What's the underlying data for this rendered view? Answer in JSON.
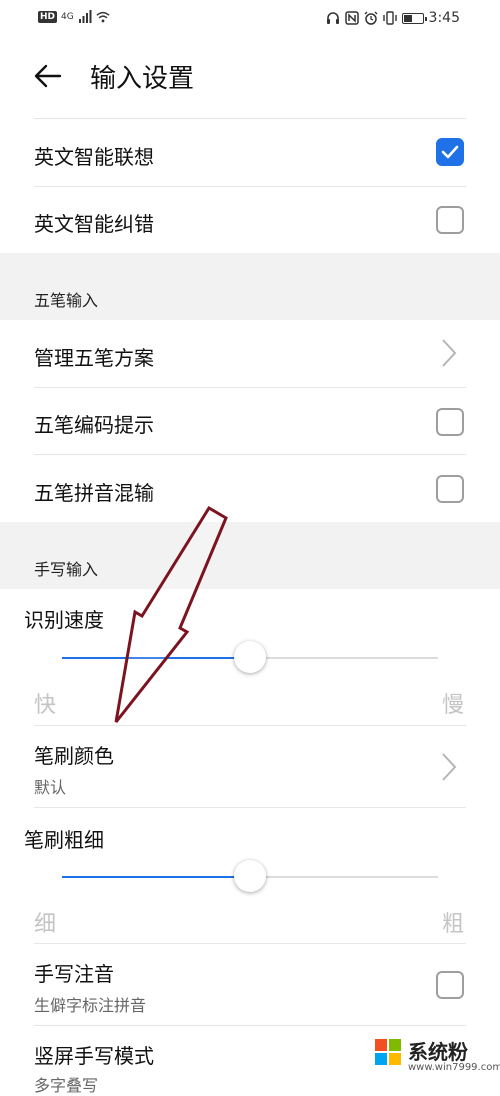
{
  "status_bar": {
    "hd": "HD",
    "network": "4G",
    "time": "3:45"
  },
  "header": {
    "title": "输入设置"
  },
  "english": {
    "items": [
      {
        "label": "英文智能联想",
        "checked": true
      },
      {
        "label": "英文智能纠错",
        "checked": false
      }
    ]
  },
  "wubi": {
    "section_title": "五笔输入",
    "manage_label": "管理五笔方案",
    "items": [
      {
        "label": "五笔编码提示",
        "checked": false
      },
      {
        "label": "五笔拼音混输",
        "checked": false
      }
    ]
  },
  "handwriting": {
    "section_title": "手写输入",
    "speed": {
      "label": "识别速度",
      "value": 0.5,
      "min_label": "快",
      "max_label": "慢"
    },
    "brush_color": {
      "label": "笔刷颜色",
      "value": "默认"
    },
    "brush_width": {
      "label": "笔刷粗细",
      "value": 0.5,
      "min_label": "细",
      "max_label": "粗"
    },
    "phonetic": {
      "label": "手写注音",
      "subtitle": "生僻字标注拼音",
      "checked": false
    },
    "vertical": {
      "label": "竖屏手写模式",
      "subtitle": "多字叠写"
    }
  },
  "watermark": {
    "name": "系统粉",
    "url": "www.win7999.com"
  },
  "colors": {
    "accent": "#1f71e8",
    "annotation_arrow": "#7b1420"
  }
}
